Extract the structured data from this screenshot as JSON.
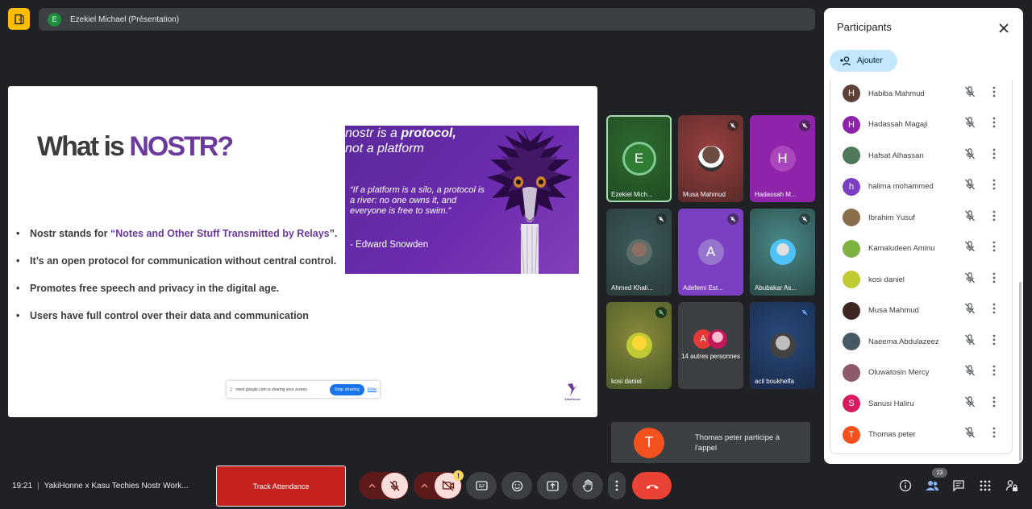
{
  "header": {
    "presenter_initial": "E",
    "presenter_title": "Ezekiel Michael (Présentation)"
  },
  "slide": {
    "title_prefix": "What is ",
    "title_accent": "NOSTR?",
    "bullets": [
      {
        "pre": "Nostr stands for ",
        "hl": "“Notes and Other Stuff Transmitted by Relays",
        "post": "”."
      },
      {
        "pre": "It’s an open protocol for communication without central control.",
        "hl": "",
        "post": ""
      },
      {
        "pre": "Promotes free speech and privacy in the digital age.",
        "hl": "",
        "post": ""
      },
      {
        "pre": "Users have full control over their data and communication",
        "hl": "",
        "post": ""
      }
    ],
    "promo_line1_pre": "nostr is a ",
    "promo_line1_bold": "protocol,",
    "promo_line2": "not a platform",
    "promo_quote": "“If a platform is a silo, a protocol is a river: no one owns it, and everyone is free to swim.”",
    "promo_author": "- Edward Snowden",
    "share_text": "meet.google.com is sharing your screen.",
    "share_stop": "Stop sharing",
    "share_hide": "Hide",
    "logo_text": "YakiHonne"
  },
  "tiles": [
    {
      "name": "Ezekiel Mich...",
      "initial": "E"
    },
    {
      "name": "Musa Mahmud",
      "initial": ""
    },
    {
      "name": "Hadassah M...",
      "initial": "H"
    },
    {
      "name": "Ahmed Khali...",
      "initial": ""
    },
    {
      "name": "Adefemi Est...",
      "initial": "A"
    },
    {
      "name": "Abubakar As...",
      "initial": ""
    },
    {
      "name": "kosi daniel",
      "initial": ""
    },
    {
      "name": "14 autres personnes",
      "initial": "A"
    },
    {
      "name": "acil boukhelfa",
      "initial": ""
    }
  ],
  "notification": {
    "initial": "T",
    "text": "Thomas peter participe à l'appel"
  },
  "panel": {
    "title": "Participants",
    "add_label": "Ajouter",
    "participants": [
      {
        "name": "Habiba Mahmud",
        "initial": "H",
        "color": "#5d4037"
      },
      {
        "name": "Hadassah Magaji",
        "initial": "H",
        "color": "#8e24aa"
      },
      {
        "name": "Hafsat Alhassan",
        "initial": "",
        "color": "#4e7a5a"
      },
      {
        "name": "halima mohammed",
        "initial": "h",
        "color": "#7b3fc4"
      },
      {
        "name": "Ibrahim Yusuf",
        "initial": "",
        "color": "#8a6d4a"
      },
      {
        "name": "Kamaludeen Aminu",
        "initial": "",
        "color": "#7cb342"
      },
      {
        "name": "kosi daniel",
        "initial": "",
        "color": "#c0ca33"
      },
      {
        "name": "Musa Mahmud",
        "initial": "",
        "color": "#3e2723"
      },
      {
        "name": "Naeema Abdulazeez",
        "initial": "",
        "color": "#455a64"
      },
      {
        "name": "Oluwatosin Mercy",
        "initial": "",
        "color": "#8d5a6a"
      },
      {
        "name": "Sanusi Haliru",
        "initial": "S",
        "color": "#d81b60"
      },
      {
        "name": "Thomas peter",
        "initial": "T",
        "color": "#f4511e"
      }
    ]
  },
  "bottom": {
    "time": "19:21",
    "meeting": "YakiHonne x Kasu Techies Nostr Work...",
    "track_label": "Track Attendance",
    "warn": "!",
    "participant_count": "23"
  },
  "colors": {
    "accent_purple": "#6c3a9c",
    "hangup_red": "#ea4335",
    "track_red": "#c5221f",
    "add_btn": "#c2e7ff"
  }
}
